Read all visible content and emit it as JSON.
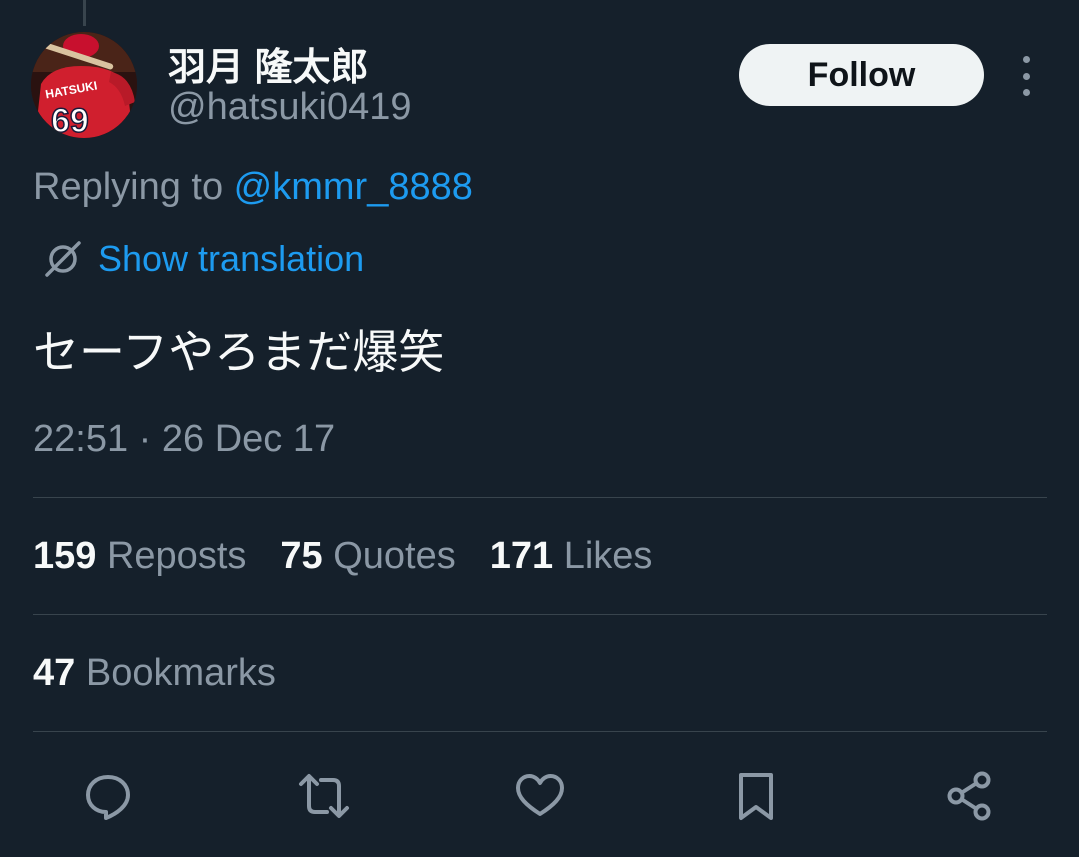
{
  "colors": {
    "background": "#15202b",
    "text_primary": "#f7f9f9",
    "text_secondary": "#8b98a5",
    "accent": "#1d9bf0",
    "divider": "#38444d",
    "follow_button_bg": "#eff3f4",
    "follow_button_text": "#0f1419"
  },
  "author": {
    "display_name": "羽月 隆太郎",
    "handle": "@hatsuki0419",
    "avatar": {
      "icon": "avatar-photo",
      "jersey_name": "HATSUKI",
      "jersey_number": "69"
    }
  },
  "header": {
    "follow_label": "Follow",
    "more_icon": "more-vertical-icon"
  },
  "reply": {
    "prefix": "Replying to ",
    "mention": "@kmmr_8888"
  },
  "translation": {
    "icon": "globe-icon",
    "label": "Show translation"
  },
  "tweet": {
    "text": "セーフやろまだ爆笑",
    "timestamp": "22:51 · 26 Dec 17"
  },
  "stats": {
    "reposts": {
      "count": "159",
      "label": "Reposts"
    },
    "quotes": {
      "count": "75",
      "label": "Quotes"
    },
    "likes": {
      "count": "171",
      "label": "Likes"
    },
    "bookmarks": {
      "count": "47",
      "label": "Bookmarks"
    }
  },
  "actions": [
    {
      "icon": "reply-icon"
    },
    {
      "icon": "repost-icon"
    },
    {
      "icon": "like-icon"
    },
    {
      "icon": "bookmark-icon"
    },
    {
      "icon": "share-icon"
    }
  ]
}
